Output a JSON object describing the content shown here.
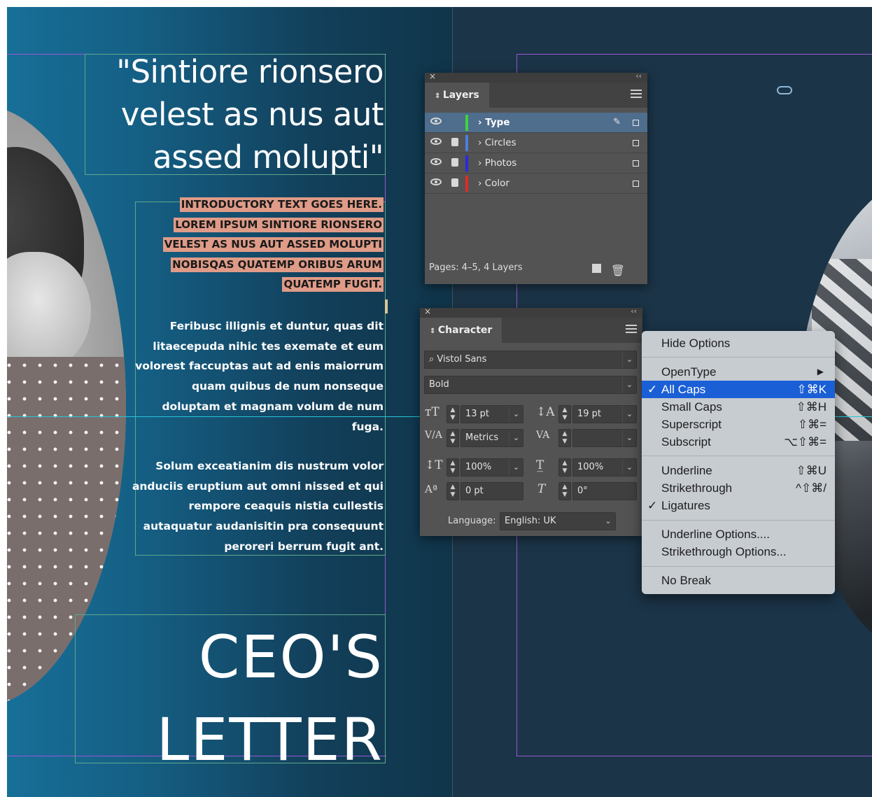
{
  "spread": {
    "quote": "\"Sintiore rionsero velest as nus aut assed molupti\"",
    "intro_lines": [
      "INTRODUCTORY TEXT GOES HERE.",
      "LOREM IPSUM SINTIORE RIONSERO",
      "VELEST AS NUS AUT ASSED MOLUPTI",
      "NOBISQAS QUATEMP ORIBUS ARUM",
      "QUATEMP FUGIT."
    ],
    "paragraph1": "Feribusc illignis et duntur, quas dit litaecepuda nihic tes exemate et eum volorest faccuptas aut ad enis maiorrum quam quibus de num nonseque doluptam et magnam volum de num fuga.",
    "paragraph2": "Solum exceatianim dis nustrum volor anduciis eruptium aut omni nissed et qui rempore ceaquis nistia cullestis autaquatur audanisitin pra consequunt peroreri berrum fugit ant.",
    "heading_line1": "CEO'S",
    "heading_line2": "LETTER"
  },
  "layers_panel": {
    "tab_label": "Layers",
    "layers": [
      {
        "name": "Type",
        "color": "#3ed43e",
        "locked": false,
        "selected": true
      },
      {
        "name": "Circles",
        "color": "#4a7fe0",
        "locked": true,
        "selected": false
      },
      {
        "name": "Photos",
        "color": "#2a2ae0",
        "locked": true,
        "selected": false
      },
      {
        "name": "Color",
        "color": "#e02a2a",
        "locked": true,
        "selected": false
      }
    ],
    "footer": "Pages: 4–5, 4 Layers"
  },
  "character_panel": {
    "tab_label": "Character",
    "font_family": "Vistol Sans",
    "font_style": "Bold",
    "font_size": "13 pt",
    "leading": "19 pt",
    "kerning": "Metrics",
    "tracking": "",
    "vertical_scale": "100%",
    "horizontal_scale": "100%",
    "baseline_shift": "0 pt",
    "skew": "0°",
    "language_label": "Language:",
    "language": "English: UK"
  },
  "context_menu": {
    "hide_options": "Hide Options",
    "opentype": "OpenType",
    "all_caps": "All Caps",
    "all_caps_shortcut": "⇧⌘K",
    "small_caps": "Small Caps",
    "small_caps_shortcut": "⇧⌘H",
    "superscript": "Superscript",
    "superscript_shortcut": "⇧⌘=",
    "subscript": "Subscript",
    "subscript_shortcut": "⌥⇧⌘=",
    "underline": "Underline",
    "underline_shortcut": "⇧⌘U",
    "strikethrough": "Strikethrough",
    "strikethrough_shortcut": "^⇧⌘/",
    "ligatures": "Ligatures",
    "underline_options": "Underline Options....",
    "strikethrough_options": "Strikethrough Options...",
    "no_break": "No Break",
    "check_mark": "✓",
    "submenu_arrow": "▶"
  },
  "colors": {
    "menu_highlight": "#1a5fd6",
    "intro_highlight": "#df9b87",
    "guide": "#9d55d6"
  }
}
